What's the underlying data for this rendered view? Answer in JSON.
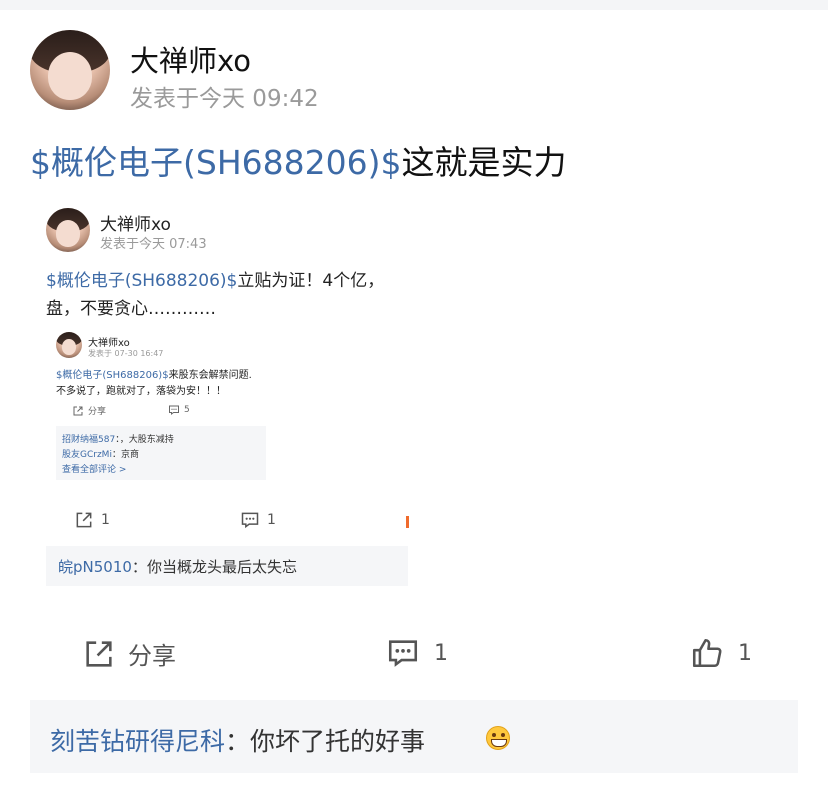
{
  "post": {
    "author": "大禅师xo",
    "meta": "发表于今天 09:42",
    "stock_tag": "$概伦电子(SH688206)$",
    "text": "这就是实力"
  },
  "embedded": {
    "author": "大禅师xo",
    "meta": "发表于今天 07:43",
    "stock_tag": "$概伦电子(SH688206)$",
    "text_line1": "立贴为证！4个亿，",
    "text_line2": "盘，不要贪心…………",
    "share_count": "1",
    "comment_count": "1",
    "comment": {
      "user": "皖pN5010",
      "sep": "：",
      "text": "你当概龙头最后太失忘"
    },
    "inner": {
      "author": "大禅师xo",
      "meta": "发表于 07-30 16:47",
      "stock_tag": "$概伦电子(SH688206)$",
      "text_line1": "来股东会解禁问题.",
      "text_line2": "不多说了，跑就对了，落袋为安！！！",
      "share_label": "分享",
      "comment_count": "5",
      "comments": [
        {
          "user": "招财纳福587",
          "sep": "：，",
          "text": "大股东减持"
        },
        {
          "user": "股友GCrzMi",
          "sep": "：",
          "text": "京商"
        }
      ],
      "view_all": "查看全部评论 >"
    }
  },
  "actions": {
    "share_label": "分享",
    "comment_count": "1",
    "like_count": "1"
  },
  "comment": {
    "user": "刻苦钻研得尼科",
    "sep": "：",
    "text": "你坏了托的好事",
    "emoji": "grinning-emoji"
  },
  "colors": {
    "link": "#3d6aa6",
    "muted": "#9a9a9a",
    "comment_bg": "#f5f6f8",
    "accent": "#f06b2c"
  }
}
